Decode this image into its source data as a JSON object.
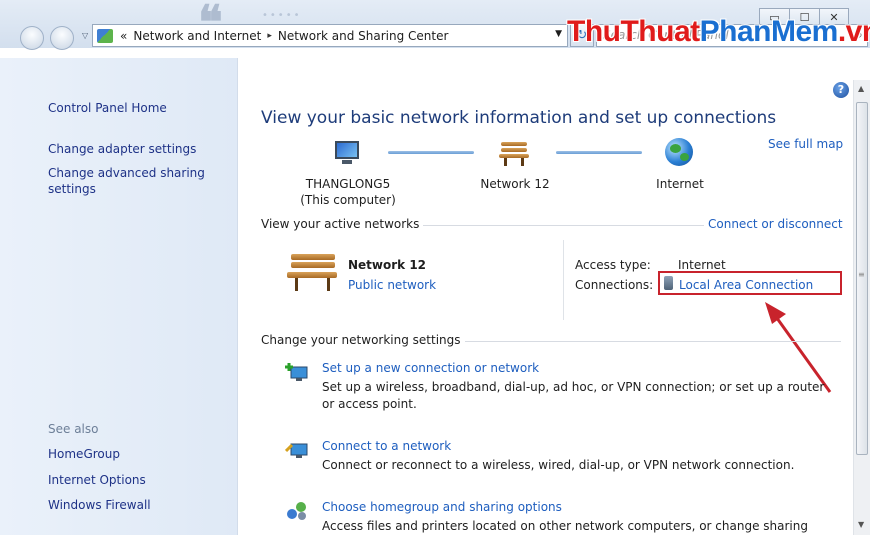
{
  "window": {
    "minimize_glyph": "▭",
    "maximize_glyph": "☐",
    "close_glyph": "✕"
  },
  "address": {
    "overflow": "«",
    "segments": [
      "Network and Internet",
      "Network and Sharing Center"
    ],
    "separator": "▸",
    "dropdown_glyph": "▼",
    "refresh_glyph": "↻"
  },
  "search": {
    "placeholder": "Search Control Panel",
    "icon": "search-icon"
  },
  "watermark": {
    "part1": "Thu",
    "part2": "Thuat",
    "part3": "PhanMem",
    "part4": ".vn"
  },
  "sidebar": {
    "items": [
      {
        "label": "Control Panel Home"
      },
      {
        "label": "Change adapter settings"
      },
      {
        "label": "Change advanced sharing settings"
      }
    ],
    "see_also_label": "See also",
    "see_also": [
      {
        "label": "HomeGroup"
      },
      {
        "label": "Internet Options"
      },
      {
        "label": "Windows Firewall"
      }
    ]
  },
  "main": {
    "help_glyph": "?",
    "title": "View your basic network information and set up connections",
    "see_full_map": "See full map",
    "map": {
      "computer_name": "THANGLONG5",
      "computer_sub": "(This computer)",
      "network": "Network 12",
      "internet": "Internet"
    },
    "active_networks": {
      "heading": "View your active networks",
      "action": "Connect or disconnect",
      "network_name": "Network  12",
      "network_type": "Public network",
      "access_type_label": "Access type:",
      "access_type_value": "Internet",
      "connections_label": "Connections:",
      "connection_link": "Local Area Connection"
    },
    "settings": {
      "heading": "Change your networking settings",
      "tasks": [
        {
          "link": "Set up a new connection or network",
          "desc": "Set up a wireless, broadband, dial-up, ad hoc, or VPN connection; or set up a router or access point.",
          "icon": "new-connection-icon"
        },
        {
          "link": "Connect to a network",
          "desc": "Connect or reconnect to a wireless, wired, dial-up, or VPN network connection.",
          "icon": "connect-network-icon"
        },
        {
          "link": "Choose homegroup and sharing options",
          "desc": "Access files and printers located on other network computers, or change sharing",
          "icon": "homegroup-icon"
        }
      ]
    }
  },
  "colors": {
    "link": "#1e5ebf",
    "highlight": "#c8232c",
    "watermark_red": "#e01b1b",
    "watermark_blue": "#1a6fd1"
  }
}
